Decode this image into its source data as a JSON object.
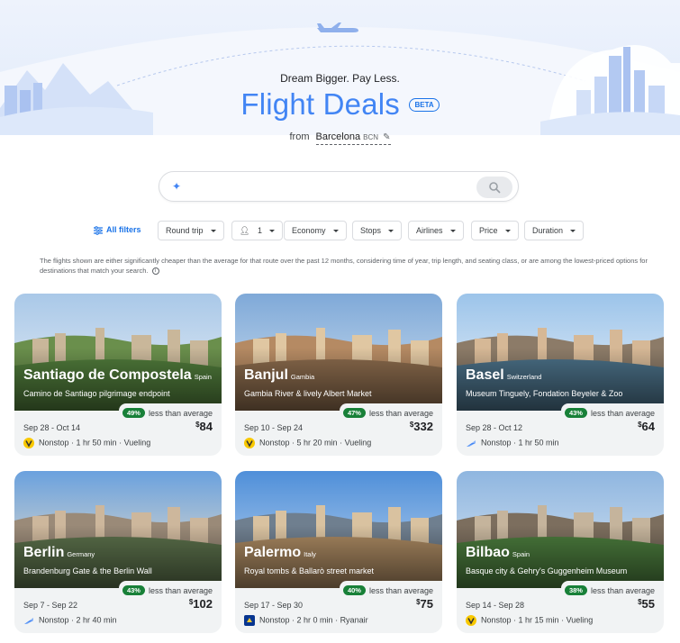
{
  "header": {
    "tagline": "Dream Bigger. Pay Less.",
    "title": "Flight Deals",
    "beta": "BETA",
    "from_label": "from",
    "from_city": "Barcelona",
    "from_code": "BCN"
  },
  "search": {
    "placeholder": ""
  },
  "filters": {
    "all": "All filters",
    "round_trip": "Round trip",
    "passengers": "1",
    "cabin": "Economy",
    "stops": "Stops",
    "airlines": "Airlines",
    "price": "Price",
    "duration": "Duration"
  },
  "disclaimer": "The flights shown are either significantly cheaper than the average for that route over the past 12 months, considering time of year, trip length, and seating class, or are among the lowest-priced options for destinations that match your search.",
  "less_label": "less than average",
  "cards": [
    {
      "city": "Santiago de Compostela",
      "country": "Spain",
      "desc": "Camino de Santiago pilgrimage endpoint",
      "pct": "49%",
      "dates": "Sep 28 - Oct 14",
      "price": "84",
      "currency": "$",
      "stops": "Nonstop",
      "duration": "1 hr 50 min",
      "airline": "Vueling",
      "airline_icon": "vueling-logo"
    },
    {
      "city": "Banjul",
      "country": "Gambia",
      "desc": "Gambia River & lively Albert Market",
      "pct": "47%",
      "dates": "Sep 10 - Sep 24",
      "price": "332",
      "currency": "$",
      "stops": "Nonstop",
      "duration": "5 hr 20 min",
      "airline": "Vueling",
      "airline_icon": "vueling-logo"
    },
    {
      "city": "Basel",
      "country": "Switzerland",
      "desc": "Museum Tinguely, Fondation Beyeler & Zoo",
      "pct": "43%",
      "dates": "Sep 28 - Oct 12",
      "price": "64",
      "currency": "$",
      "stops": "Nonstop",
      "duration": "1 hr 50 min",
      "airline": "",
      "airline_icon": "generic-airline-logo"
    },
    {
      "city": "Berlin",
      "country": "Germany",
      "desc": "Brandenburg Gate & the Berlin Wall",
      "pct": "43%",
      "dates": "Sep 7 - Sep 22",
      "price": "102",
      "currency": "$",
      "stops": "Nonstop",
      "duration": "2 hr 40 min",
      "airline": "",
      "airline_icon": "generic-airline-logo"
    },
    {
      "city": "Palermo",
      "country": "Italy",
      "desc": "Royal tombs & Ballarò street market",
      "pct": "40%",
      "dates": "Sep 17 - Sep 30",
      "price": "75",
      "currency": "$",
      "stops": "Nonstop",
      "duration": "2 hr 0 min",
      "airline": "Ryanair",
      "airline_icon": "ryanair-logo"
    },
    {
      "city": "Bilbao",
      "country": "Spain",
      "desc": "Basque city & Gehry's Guggenheim Museum",
      "pct": "38%",
      "dates": "Sep 14 - Sep 28",
      "price": "55",
      "currency": "$",
      "stops": "Nonstop",
      "duration": "1 hr 15 min",
      "airline": "Vueling",
      "airline_icon": "vueling-logo"
    }
  ],
  "colors": {
    "accent": "#1a73e8",
    "title": "#4285f4",
    "deal_badge": "#188038",
    "card_bg": "#f1f3f4"
  }
}
